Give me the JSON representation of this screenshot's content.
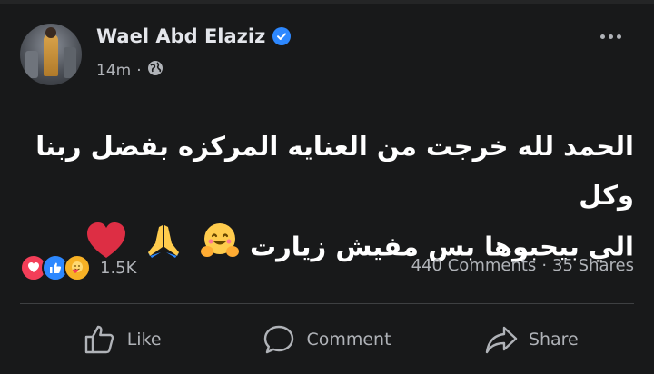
{
  "post": {
    "author": "Wael Abd Elaziz",
    "time": "14m",
    "separator": "·",
    "privacy_icon": "globe-icon",
    "text_line1": "الحمد لله خرجت من العنايه المركزه بفضل ربنا وكل",
    "text_line2": "الي بيحبوها بس مفيش زيارت",
    "emojis": [
      "hugging-face",
      "folded-hands",
      "red-heart"
    ]
  },
  "reactions": {
    "types": [
      "love",
      "like",
      "care"
    ],
    "count": "1.5K"
  },
  "engagement": {
    "comments": "440 Comments",
    "separator": "·",
    "shares": "35 Shares"
  },
  "actions": {
    "like_label": "Like",
    "comment_label": "Comment",
    "share_label": "Share"
  },
  "colors": {
    "background": "#18191a",
    "verified": "#2d88ff",
    "love": "#f33e58",
    "like": "#2d88ff",
    "care": "#f7b125",
    "secondary_text": "#b0b3b8"
  }
}
